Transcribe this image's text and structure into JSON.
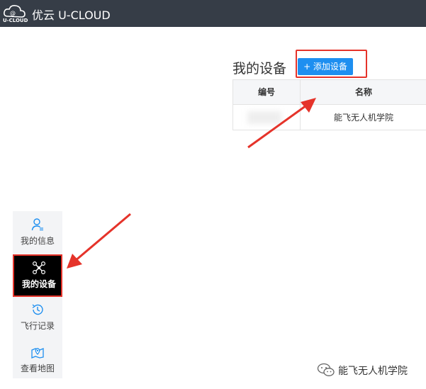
{
  "header": {
    "logo_text": "U-CLOUD",
    "title": "优云 U-CLOUD",
    "background": "#363d47"
  },
  "main": {
    "page_title": "我的设备",
    "add_button_label": "+ 添加设备",
    "table": {
      "columns": [
        "编号",
        "名称"
      ],
      "rows": [
        {
          "id": "",
          "name": "能飞无人机学院"
        }
      ]
    }
  },
  "sidebar": {
    "items": [
      {
        "label": "我的信息",
        "icon": "user-icon",
        "active": false
      },
      {
        "label": "我的设备",
        "icon": "drone-icon",
        "active": true
      },
      {
        "label": "飞行记录",
        "icon": "history-icon",
        "active": false
      },
      {
        "label": "查看地图",
        "icon": "map-icon",
        "active": false
      }
    ]
  },
  "watermark": {
    "text": "能飞无人机学院",
    "icon": "wechat-icon"
  },
  "colors": {
    "accent": "#1e8ff0",
    "highlight": "#e5332a",
    "sidebar_bg": "#f3f4f6",
    "active_bg": "#000000"
  }
}
